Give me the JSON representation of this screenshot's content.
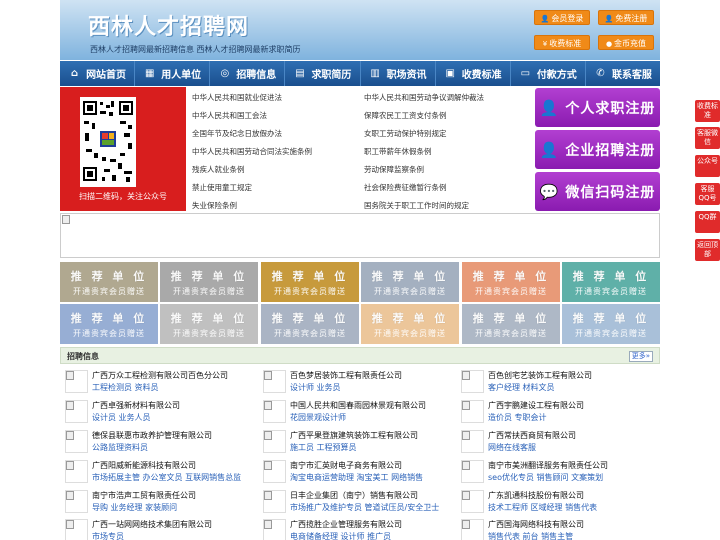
{
  "header": {
    "site_title": "西林人才招聘网",
    "subtitle": "西林人才招聘网最新招聘信息    西林人才招聘网最新求职简历",
    "buttons": [
      "会员登录",
      "免费注册",
      "收费标准",
      "金币充值"
    ]
  },
  "nav": [
    {
      "label": "网站首页",
      "icon": "home-icon"
    },
    {
      "label": "用人单位",
      "icon": "building-icon"
    },
    {
      "label": "招聘信息",
      "icon": "link-icon"
    },
    {
      "label": "求职简历",
      "icon": "document-icon"
    },
    {
      "label": "职场资讯",
      "icon": "news-icon"
    },
    {
      "label": "收费标准",
      "icon": "money-icon"
    },
    {
      "label": "付款方式",
      "icon": "card-icon"
    },
    {
      "label": "联系客服",
      "icon": "phone-icon"
    }
  ],
  "qr": {
    "caption": "扫描二维码，关注公众号"
  },
  "laws": [
    "中华人民共和国就业促进法",
    "中华人民共和国劳动争议调解仲裁法",
    "中华人民共和国工会法",
    "保障农民工工资支付条例",
    "全国年节及纪念日放假办法",
    "女职工劳动保护特别规定",
    "中华人民共和国劳动合同法实施条例",
    "职工带薪年休假条例",
    "残疾人就业条例",
    "劳动保障监察条例",
    "禁止使用童工规定",
    "社会保险费征缴暂行条例",
    "失业保险条例",
    "国务院关于职工工作时间的规定"
  ],
  "register": [
    {
      "label": "个人求职注册",
      "icon": "person-icon"
    },
    {
      "label": "企业招聘注册",
      "icon": "company-user-icon"
    },
    {
      "label": "微信扫码注册",
      "icon": "wechat-icon"
    }
  ],
  "promo": {
    "line1": "推 荐 单 位",
    "line2": "开通贵宾会员赠送",
    "colors": [
      "#b0a890",
      "#a9a9a9",
      "#c79a3c",
      "#a4b0c0",
      "#e89a78",
      "#5fb0a8",
      "#97aed4",
      "#c0c0c0",
      "#aab4c4",
      "#ecc69a",
      "#aeb8c6",
      "#a9c0d9"
    ]
  },
  "section": {
    "title": "招聘信息",
    "more": "更多»"
  },
  "companies": [
    {
      "name": "广西万众工程检测有限公司百色分公司",
      "jobs": "工程检测员 资料员"
    },
    {
      "name": "百色梦居装饰工程有限责任公司",
      "jobs": "设计师 业务员"
    },
    {
      "name": "百色创宅艺装饰工程有限公司",
      "jobs": "客户经理 材料文员"
    },
    {
      "name": "广西卓强新材料有限公司",
      "jobs": "设计员 业务人员"
    },
    {
      "name": "中国人民共和国春雨园林景观有限公司",
      "jobs": "花园景观设计师"
    },
    {
      "name": "广西宇鹏建设工程有限公司",
      "jobs": "造价员 专职会计"
    },
    {
      "name": "德保县联惠市政养护管理有限公司",
      "jobs": "公路监理资料员"
    },
    {
      "name": "广西平果登旗建筑装饰工程有限公司",
      "jobs": "施工员 工程预算员"
    },
    {
      "name": "广西常扶西商贸有限公司",
      "jobs": "网络在线客服"
    },
    {
      "name": "广西阳威新能源科技有限公司",
      "jobs": "市场拓展主管 办公室文员 互联网销售总监"
    },
    {
      "name": "南宁市汇英财电子商务有限公司",
      "jobs": "淘宝电商运营助理 淘宝美工 网络销售"
    },
    {
      "name": "南宁市美洲翻译服务有限责任公司",
      "jobs": "seo优化专员 销售顾问 文案策划"
    },
    {
      "name": "南宁市浩声工贸有限责任公司",
      "jobs": "导购 业务经理 家装顾问"
    },
    {
      "name": "日丰企业集团（南宁）销售有限公司",
      "jobs": "市场推广及维护专员 管道试压员/安全卫士"
    },
    {
      "name": "广东凯通科技股份有限公司",
      "jobs": "技术工程师 区域经理 销售代表"
    },
    {
      "name": "广西一站网网络技术集团有限公司",
      "jobs": "市场专员"
    },
    {
      "name": "广西揽胜企业管理服务有限公司",
      "jobs": "电商储备经理 设计师 推广员"
    },
    {
      "name": "广西国海网络科技有限公司",
      "jobs": "销售代表 前台 销售主管"
    }
  ],
  "side_tabs": [
    "收费标准",
    "客服微信",
    "公众号",
    "客服QQ号",
    "QQ群",
    "返回顶部"
  ]
}
